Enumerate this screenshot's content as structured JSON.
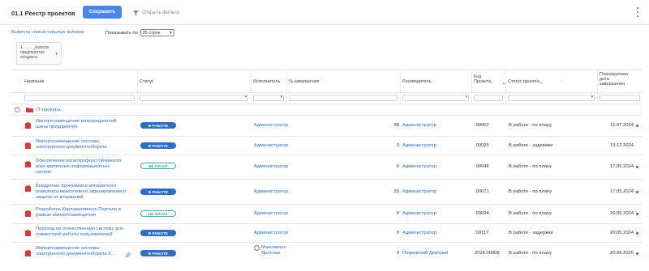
{
  "header": {
    "title": "01.1 Реестр проектов",
    "save_label": "Сохранить",
    "filter_label": "Открыть фильтр"
  },
  "toolbar": {
    "hidden_columns_link": "Вывести список скрытых колонок",
    "show_per_page_label": "Показывать по",
    "page_size_value": "25 строк"
  },
  "catalog_filter": {
    "line1": "1 . . . . _Каталог",
    "line2": "предприятия",
    "line3": "холдинга"
  },
  "columns": {
    "name": "Название",
    "status": "Статус",
    "executor": "Исполнитель",
    "pct": "% завершения",
    "manager": "Руководитель",
    "code_l1": "Код",
    "code_l2": "Проекта_",
    "proj_status": "Статус проекта_",
    "date_l1": "Планируемая",
    "date_l2": "дата",
    "date_l3": "завершения"
  },
  "group": {
    "label": "IT-проекты..."
  },
  "rows": [
    {
      "name_l1": "Импортозамещение интеграционной",
      "name_l2": "шины предприятия",
      "name_l3": "",
      "status": "В РАБОТЕ",
      "status_kind": "work",
      "executor": "Администратор",
      "executor_l2": "",
      "pct": "98",
      "manager": "Администратор",
      "code": ".00002",
      "proj_status": "В работе - по плану",
      "date": "15.07.2024",
      "overdue": true
    },
    {
      "name_l1": "Импортозамещение системы",
      "name_l2": "электронного документооборота",
      "name_l3": "",
      "status": "В РАБОТЕ",
      "status_kind": "work",
      "executor": "Администратор",
      "executor_l2": "",
      "pct": "0",
      "manager": "Администратор",
      "code": ".00025",
      "proj_status": "В работе - задержки",
      "date": "13.12.2024",
      "overdue": false
    },
    {
      "name_l1": "Обеспечение катастрофоустойчивости",
      "name_l2": "всех критичных информационных",
      "name_l3": "систем",
      "status": "НЕ НАЧАТ",
      "status_kind": "new",
      "executor": "Администратор",
      "executor_l2": "",
      "pct": "0",
      "manager": "Администратор",
      "code": ".00048",
      "proj_status": "В работе - по плану",
      "date": "17.05.2024",
      "overdue": true
    },
    {
      "name_l1": "Внедрение программно-аппаратного",
      "name_l2": "комплекса межсетевого экранирования и",
      "name_l3": "защиты от вторжений",
      "status": "В РАБОТЕ",
      "status_kind": "work",
      "executor": "Администратор",
      "executor_l2": "",
      "pct": "33",
      "manager": "Администратор",
      "code": ".00071",
      "proj_status": "В работе - по плану",
      "date": "17.05.2024",
      "overdue": true
    },
    {
      "name_l1": "Разработка Корпоративного Портала в",
      "name_l2": "рамках импортозамещения",
      "name_l3": "",
      "status": "НЕ НАЧАТ",
      "status_kind": "new",
      "executor": "Администратор",
      "executor_l2": "",
      "pct": "0",
      "manager": "Администратор",
      "code": ".00094",
      "proj_status": "В работе - по плану",
      "date": "20.05.2024",
      "overdue": true
    },
    {
      "name_l1": "Переход на отечественную систему для",
      "name_l2": "совместной работы пользователей",
      "name_l3": "",
      "status": "В РАБОТЕ",
      "status_kind": "work",
      "executor": "Администратор",
      "executor_l2": "",
      "pct": "0",
      "manager": "Администратор",
      "code": ".00117",
      "proj_status": "В работе - задержки",
      "date": "20.05.2024",
      "overdue": true
    },
    {
      "name_l1": "Импортозамещение системы",
      "name_l2": "электронного документооборота К ...",
      "name_l3": "",
      "status": "В РАБОТЕ",
      "status_kind": "work",
      "executor": "Максимлин",
      "executor_l2": "Ярослав",
      "pct": "9",
      "manager": "Покровский Дмитрий",
      "code": "2024.00008",
      "proj_status": "В работе - по плану",
      "date": "20.08.2025",
      "overdue": true
    }
  ]
}
